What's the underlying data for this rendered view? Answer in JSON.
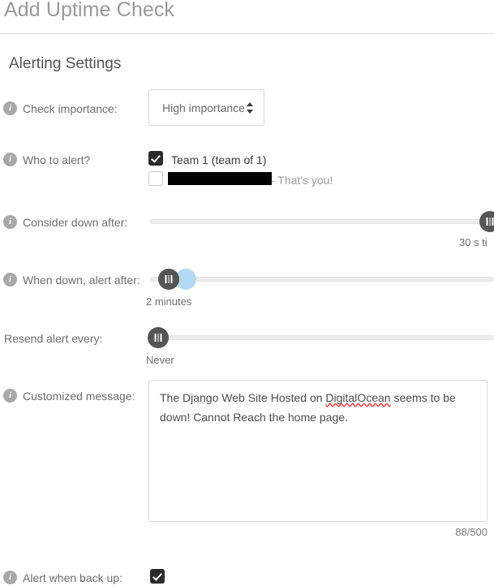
{
  "header": {
    "title": "Add Uptime Check",
    "section_title": "Alerting Settings"
  },
  "icons": {
    "info": "i"
  },
  "fields": {
    "check_importance": {
      "label": "Check importance:",
      "value": "High importance",
      "options": [
        "High importance"
      ]
    },
    "who_to_alert": {
      "label": "Who to alert?",
      "options": [
        {
          "label": "Team 1 (team of 1)",
          "checked": true
        },
        {
          "label": "",
          "suffix": "- That's you!",
          "checked": false,
          "redacted": true
        }
      ]
    },
    "consider_down_after": {
      "label": "Consider down after:",
      "value": "30 s ti"
    },
    "when_down_alert_after": {
      "label": "When down, alert after:",
      "value": "2 minutes"
    },
    "resend_alert_every": {
      "label": "Resend alert every:",
      "value": "Never"
    },
    "customized_message": {
      "label": "Customized message:",
      "text_before": "The Django Web Site Hosted on ",
      "text_misspelled": "DigitalOcean",
      "text_after": " seems to be down! Cannot Reach the home page.",
      "counter": "88/500",
      "max_length": "500",
      "used_length": "88"
    },
    "alert_when_back_up": {
      "label": "Alert when back up:",
      "checked": true
    }
  },
  "colors": {
    "accent_blue": "#b3daf4",
    "handle_gray": "#555555",
    "checkbox_dark": "#2b2b2b",
    "spellcheck_red": "#e03a3a",
    "info_icon_gray": "#a8a8a8"
  }
}
